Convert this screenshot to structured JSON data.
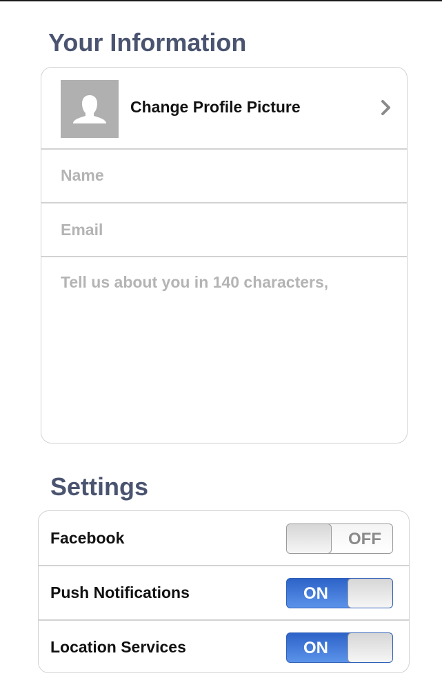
{
  "info_section": {
    "title": "Your Information",
    "profile_row": {
      "label": "Change Profile Picture",
      "avatar_icon": "person-silhouette-icon",
      "chevron_icon": "chevron-right-icon"
    },
    "name_field": {
      "value": "",
      "placeholder": "Name"
    },
    "email_field": {
      "value": "",
      "placeholder": "Email"
    },
    "bio_field": {
      "value": "",
      "placeholder": "Tell us about you in 140 characters,"
    }
  },
  "settings_section": {
    "title": "Settings",
    "items": [
      {
        "label": "Facebook",
        "state": "OFF",
        "on": false
      },
      {
        "label": "Push Notifications",
        "state": "ON",
        "on": true
      },
      {
        "label": "Location Services",
        "state": "ON",
        "on": true
      }
    ]
  },
  "colors": {
    "section_title": "#4a5470",
    "toggle_on": "#2d63c8",
    "placeholder": "#b4b4b4",
    "border": "#d2d2d2"
  }
}
